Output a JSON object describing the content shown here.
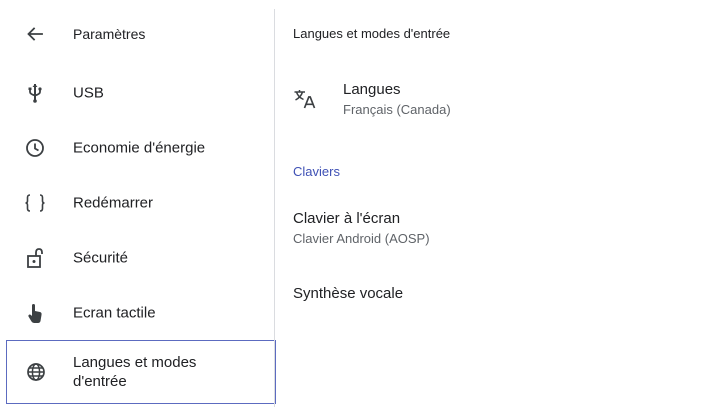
{
  "sidebar": {
    "title": "Paramètres",
    "items": [
      {
        "label": "USB",
        "icon": "usb-icon"
      },
      {
        "label": "Economie d'énergie",
        "icon": "clock-icon"
      },
      {
        "label": "Redémarrer",
        "icon": "curly-braces-icon"
      },
      {
        "label": "Sécurité",
        "icon": "unlocked-padlock-icon"
      },
      {
        "label": "Ecran tactile",
        "icon": "touch-hand-icon"
      },
      {
        "label_line1": "Langues et modes",
        "label_line2": "d'entrée",
        "icon": "globe-icon",
        "selected": true
      }
    ]
  },
  "content": {
    "header": "Langues et modes d'entrée",
    "languages": {
      "title": "Langues",
      "summary": "Français (Canada)",
      "icon": "translate-icon"
    },
    "keyboards_category": "Claviers",
    "onscreen_keyboard": {
      "title": "Clavier à l'écran",
      "summary": "Clavier Android (AOSP)"
    },
    "tts": {
      "title": "Synthèse vocale"
    }
  },
  "colors": {
    "accent": "#3f51b5",
    "selected_border": "#5c6bc0",
    "icon": "#3c4043",
    "text": "#202124",
    "secondary_text": "#5f6368"
  }
}
